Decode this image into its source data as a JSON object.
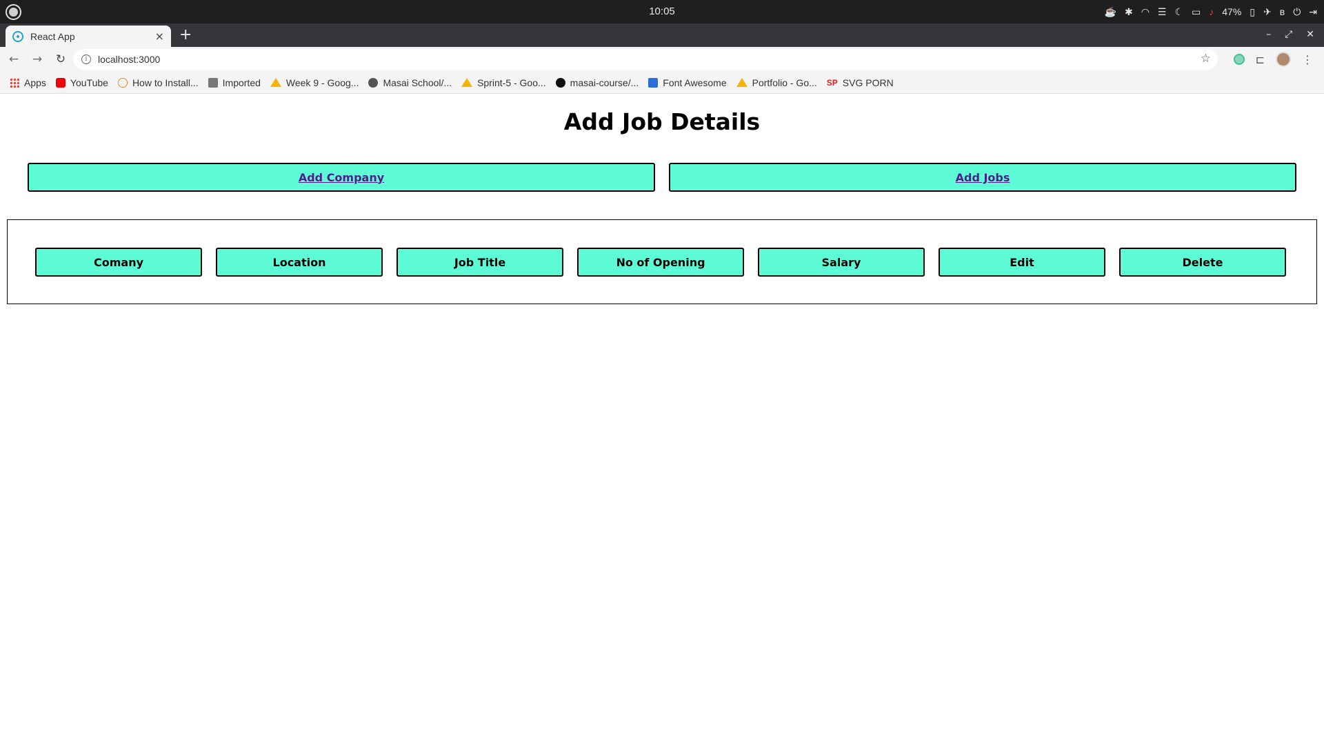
{
  "os": {
    "clock": "10:05",
    "battery": "47%"
  },
  "browser": {
    "tab_title": "React App",
    "tab_close": "×",
    "new_tab": "+",
    "url": "localhost:3000",
    "bookmarks": [
      {
        "label": "Apps",
        "icon": "apps-grid-icon"
      },
      {
        "label": "YouTube",
        "icon": "youtube-icon"
      },
      {
        "label": "How to Install...",
        "icon": "site-icon"
      },
      {
        "label": "Imported",
        "icon": "folder-icon"
      },
      {
        "label": "Week 9 - Goog...",
        "icon": "google-drive-icon"
      },
      {
        "label": "Masai School/...",
        "icon": "globe-icon"
      },
      {
        "label": "Sprint-5 - Goo...",
        "icon": "google-drive-icon"
      },
      {
        "label": "masai-course/...",
        "icon": "github-icon"
      },
      {
        "label": "Font Awesome",
        "icon": "font-awesome-icon"
      },
      {
        "label": "Portfolio - Go...",
        "icon": "google-drive-icon"
      },
      {
        "label": "SVG PORN",
        "icon": "svg-porn-icon"
      }
    ],
    "sp_glyph": "SP"
  },
  "page": {
    "title": "Add Job Details",
    "add_company": "Add Company",
    "add_jobs": "Add Jobs",
    "columns": [
      "Comany",
      "Location",
      "Job Title",
      "No of Opening",
      "Salary",
      "Edit",
      "Delete"
    ],
    "accent_color": "#5dfcd6"
  }
}
